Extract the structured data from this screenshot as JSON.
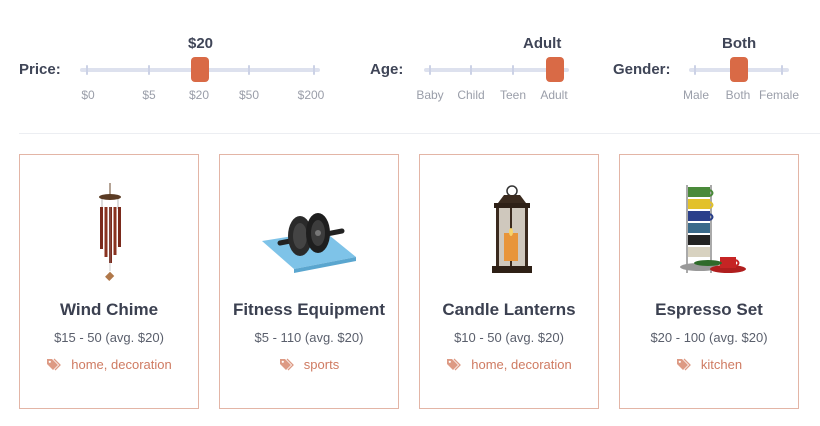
{
  "filters": {
    "price": {
      "label": "Price:",
      "value": "$20",
      "ticks": [
        "$0",
        "$5",
        "$20",
        "$50",
        "$200"
      ],
      "selected_index": 2
    },
    "age": {
      "label": "Age:",
      "value": "Adult",
      "ticks": [
        "Baby",
        "Child",
        "Teen",
        "Adult"
      ],
      "selected_index": 3
    },
    "gender": {
      "label": "Gender:",
      "value": "Both",
      "ticks": [
        "Male",
        "Both",
        "Female"
      ],
      "selected_index": 1
    }
  },
  "products": [
    {
      "title": "Wind Chime",
      "price": "$15 - 50 (avg. $20)",
      "tags": "home, decoration",
      "icon": "wind-chime-image"
    },
    {
      "title": "Fitness Equipment",
      "price": "$5 - 110 (avg. $20)",
      "tags": "sports",
      "icon": "ab-roller-image"
    },
    {
      "title": "Candle Lanterns",
      "price": "$10 - 50 (avg. $20)",
      "tags": "home, decoration",
      "icon": "lantern-image"
    },
    {
      "title": "Espresso Set",
      "price": "$20 - 100 (avg. $20)",
      "tags": "kitchen",
      "icon": "espresso-cups-image"
    }
  ],
  "colors": {
    "accent": "#d96a46",
    "track": "#dde1ee",
    "card_border": "#e3b5a6",
    "tag_text": "#cf7b62"
  }
}
